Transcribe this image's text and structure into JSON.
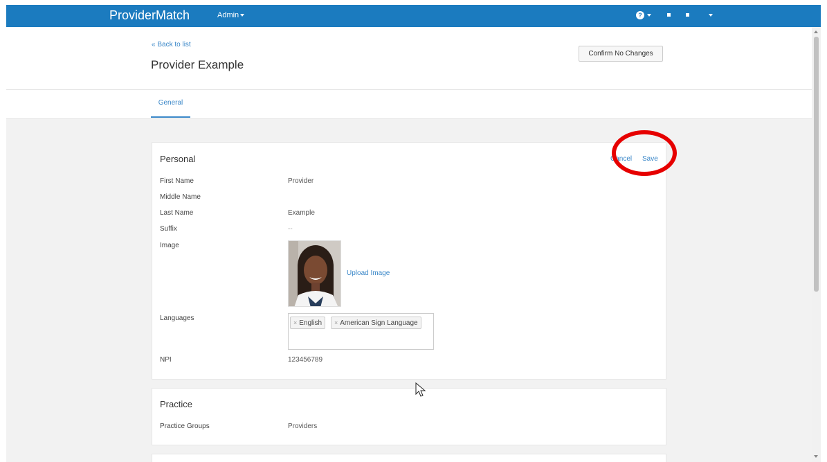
{
  "topnav": {
    "brand": "ProviderMatch",
    "admin_label": "Admin",
    "help_icon": "?",
    "icons": [
      "help-icon",
      "square-icon",
      "square-icon",
      "chevron-down-icon"
    ]
  },
  "header": {
    "back_link": "« Back to list",
    "title": "Provider Example",
    "confirm_button": "Confirm No Changes"
  },
  "tabs": [
    {
      "label": "General",
      "active": true
    }
  ],
  "personal": {
    "title": "Personal",
    "cancel": "Cancel",
    "save": "Save",
    "rows": [
      {
        "label": "First Name",
        "value": "Provider"
      },
      {
        "label": "Middle Name",
        "value": ""
      },
      {
        "label": "Last Name",
        "value": "Example"
      },
      {
        "label": "Suffix",
        "value": "--"
      },
      {
        "label": "Image",
        "value": ""
      },
      {
        "label": "Languages",
        "value": ""
      },
      {
        "label": "NPI",
        "value": "123456789"
      }
    ],
    "upload_image": "Upload Image",
    "languages": [
      {
        "remove": "×",
        "label": "English"
      },
      {
        "remove": "×",
        "label": "American Sign Language"
      }
    ]
  },
  "practice": {
    "title": "Practice",
    "rows": [
      {
        "label": "Practice Groups",
        "value": "Providers"
      }
    ]
  },
  "colors": {
    "nav": "#1b7bbf",
    "link": "#3a87c8",
    "highlight": "#e60000"
  }
}
